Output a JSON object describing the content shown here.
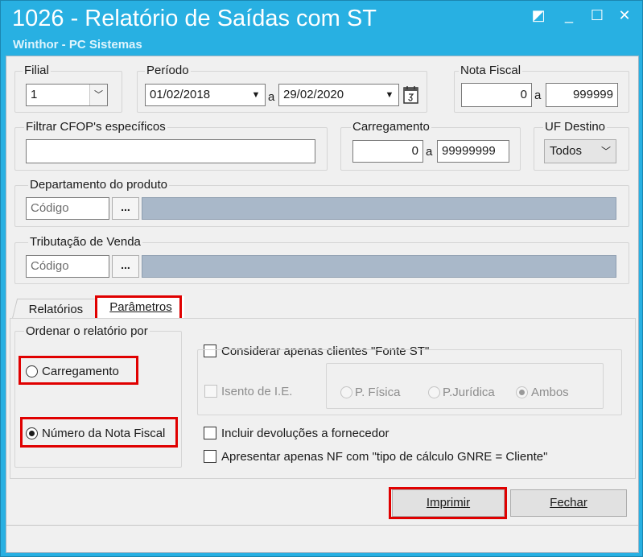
{
  "window": {
    "title": "1026 - Relatório de Saídas com ST",
    "subtitle": "Winthor - PC Sistemas",
    "controls": {
      "restore": "◩",
      "minimize": "_",
      "maximize": "☐",
      "close": "✕"
    }
  },
  "filial": {
    "label": "Filial",
    "value": "1"
  },
  "periodo": {
    "label": "Período",
    "start": "01/02/2018",
    "sep": "a",
    "end": "29/02/2020"
  },
  "nota_fiscal": {
    "label": "Nota Fiscal",
    "from": "0",
    "sep": "a",
    "to": "999999"
  },
  "cfop": {
    "label": "Filtrar CFOP's específicos",
    "value": ""
  },
  "carregamento": {
    "label": "Carregamento",
    "from": "0",
    "sep": "a",
    "to": "99999999"
  },
  "uf_destino": {
    "label": "UF Destino",
    "value": "Todos"
  },
  "departamento": {
    "label": "Departamento do produto",
    "placeholder": "Código",
    "button": "..."
  },
  "tributacao": {
    "label": "Tributação de Venda",
    "placeholder": "Código",
    "button": "..."
  },
  "tabs": [
    {
      "label": "Relatórios",
      "active": false
    },
    {
      "label": "Parâmetros",
      "active": true
    }
  ],
  "ordenar": {
    "label": "Ordenar o relatório por",
    "options": [
      {
        "label": "Carregamento",
        "selected": false
      },
      {
        "label": "Número da Nota Fiscal",
        "selected": true
      }
    ]
  },
  "params": {
    "fonte_st": {
      "label": "Considerar apenas clientes \"Fonte ST\"",
      "checked": false
    },
    "isento": {
      "label": "Isento de I.E.",
      "checked": false,
      "enabled": false
    },
    "pessoa_options": [
      {
        "label": "P. Física",
        "selected": false
      },
      {
        "label": "P.Jurídica",
        "selected": false
      },
      {
        "label": "Ambos",
        "selected": true
      }
    ],
    "devolucoes": {
      "label": "Incluir devoluções a fornecedor",
      "checked": false
    },
    "gnre": {
      "label": "Apresentar apenas NF com \"tipo de cálculo GNRE = Cliente\"",
      "checked": false
    }
  },
  "buttons": {
    "imprimir": "Imprimir",
    "fechar": "Fechar"
  },
  "colors": {
    "titlebar": "#28b0e2",
    "highlight": "#e00000",
    "readonly_bar": "#a9b8c9"
  }
}
